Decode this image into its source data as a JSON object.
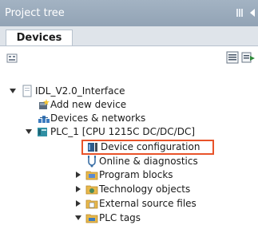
{
  "panel": {
    "title": "Project tree"
  },
  "tabs": [
    {
      "label": "Devices",
      "active": true
    }
  ],
  "toolbar": {
    "left_icon": "network-view-icon",
    "right_icons": [
      "overview-icon",
      "show-hide-icon"
    ]
  },
  "tree": {
    "project": {
      "label": "IDL_V2.0_Interface",
      "icon": "project-icon",
      "expanded": true
    },
    "add_device": {
      "label": "Add new device",
      "icon": "add-device-icon"
    },
    "devices_networks": {
      "label": "Devices & networks",
      "icon": "network-icon"
    },
    "plc": {
      "label": "PLC_1 [CPU 1215C DC/DC/DC]",
      "icon": "plc-icon",
      "expanded": true
    },
    "device_config": {
      "label": "Device configuration",
      "icon": "device-config-icon",
      "highlighted": true
    },
    "online_diag": {
      "label": "Online & diagnostics",
      "icon": "diagnostics-icon"
    },
    "program_blocks": {
      "label": "Program blocks",
      "icon": "folder-icon",
      "expanded": false
    },
    "tech_objects": {
      "label": "Technology objects",
      "icon": "folder-icon",
      "expanded": false
    },
    "ext_sources": {
      "label": "External source files",
      "icon": "folder-icon",
      "expanded": false
    },
    "plc_tags": {
      "label": "PLC tags",
      "icon": "folder-icon",
      "expanded": true
    }
  },
  "colors": {
    "highlight": "#e8532a",
    "title_bar": "#9aabbc",
    "folder": "#e8b84a"
  }
}
